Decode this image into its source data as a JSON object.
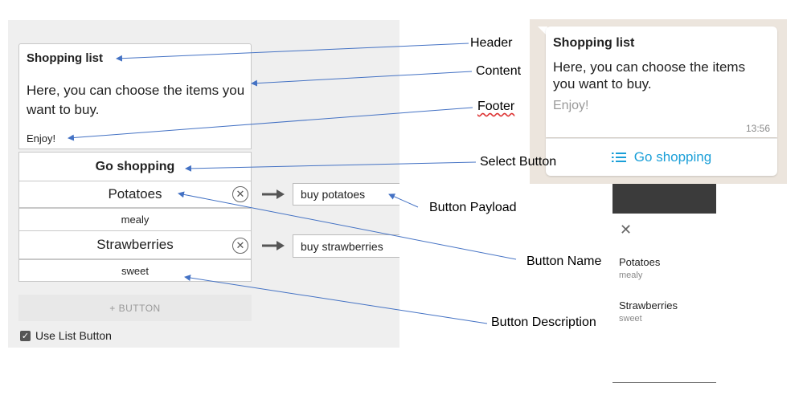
{
  "editor": {
    "header": "Shopping list",
    "content": "Here, you can choose the items you want to buy.",
    "footer": "Enjoy!",
    "select_button": "Go shopping",
    "buttons": [
      {
        "name": "Potatoes",
        "description": "mealy",
        "payload": "buy potatoes"
      },
      {
        "name": "Strawberries",
        "description": "sweet",
        "payload": "buy strawberries"
      }
    ],
    "add_button": "+ BUTTON",
    "use_list_button": "Use List Button"
  },
  "annotations": {
    "header": "Header",
    "content": "Content",
    "footer": "Footer",
    "select_button": "Select Button",
    "button_payload": "Button Payload",
    "button_name": "Button Name",
    "button_description": "Button Description"
  },
  "preview": {
    "header": "Shopping list",
    "content": "Here, you can choose the items you want to buy.",
    "footer": "Enjoy!",
    "time": "13:56",
    "button": "Go shopping",
    "list": [
      {
        "title": "Potatoes",
        "description": "mealy"
      },
      {
        "title": "Strawberries",
        "description": "sweet"
      }
    ]
  },
  "colors": {
    "arrow": "#4472c4",
    "accent": "#1a9fd8"
  }
}
